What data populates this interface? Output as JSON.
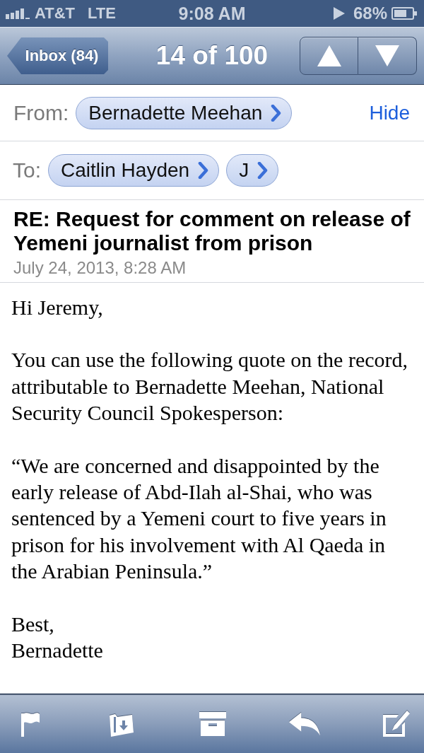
{
  "status_bar": {
    "carrier": "AT&T",
    "network": "LTE",
    "time": "9:08 AM",
    "battery": "68%"
  },
  "nav_bar": {
    "back_button": "Inbox (84)",
    "title": "14 of 100"
  },
  "header": {
    "from_label": "From:",
    "from": [
      {
        "name": "Bernadette Meehan"
      }
    ],
    "hide_link": "Hide",
    "to_label": "To:",
    "to": [
      {
        "name": "Caitlin Hayden"
      },
      {
        "name": "J"
      }
    ]
  },
  "subject": "RE: Request for comment on release of Yemeni journalist from prison",
  "date": "July 24, 2013, 8:28 AM",
  "body": {
    "greeting": "Hi Jeremy,",
    "paragraphs": [
      "You can use the following quote on the record, attributable to Bernadette Meehan, National Security Council Spokesperson:",
      "“We are concerned and disappointed by the early release of Abd-Ilah al-Shai, who was sentenced by a Yemeni court to five years in prison for his involvement with Al Qaeda in the Arabian Peninsula.”"
    ],
    "closing": "Best,",
    "signature": "Bernadette"
  }
}
